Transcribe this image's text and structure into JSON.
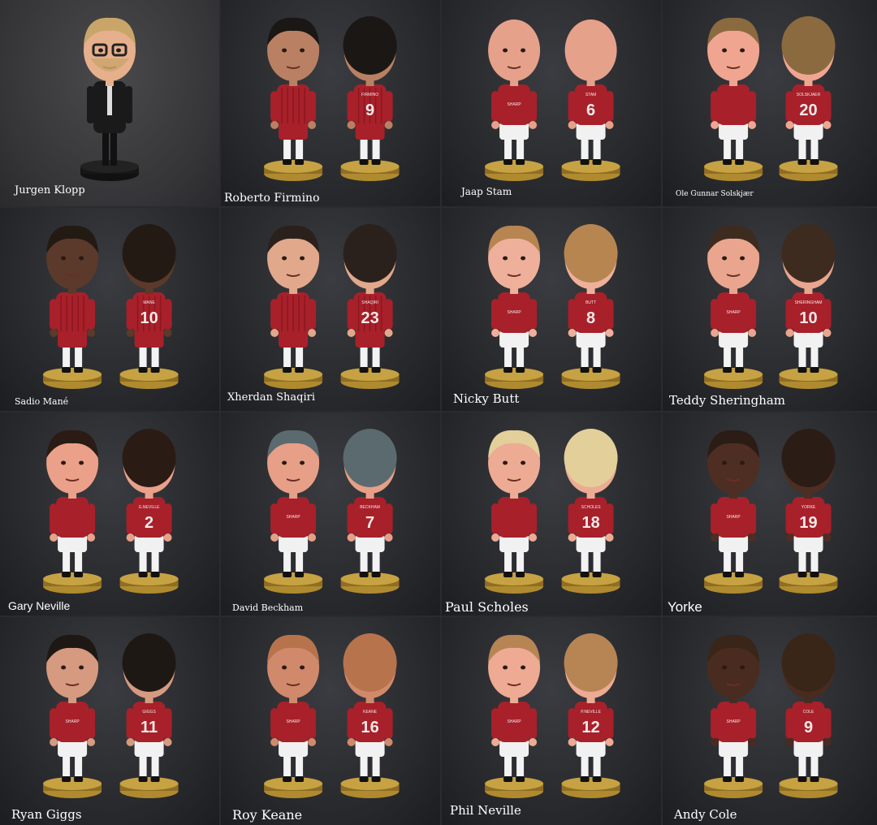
{
  "colors": {
    "skin_light": "#e9a98f",
    "skin_dark": "#5a3a2c",
    "kit_red": "#a8202a",
    "shorts_white": "#f1f1f1",
    "base_gold": "#b08a2e",
    "background": "#2a2b2e"
  },
  "tiles": [
    {
      "name": "Jurgen Klopp",
      "front_shirt": "",
      "back_name": "",
      "back_number": "",
      "outfit": "suit"
    },
    {
      "name": "Roberto Firmino",
      "front_shirt": "",
      "back_name": "FIRMINO",
      "back_number": "9",
      "outfit": "liverpool"
    },
    {
      "name": "Jaap Stam",
      "front_shirt": "SHARP",
      "back_name": "STAM",
      "back_number": "6",
      "outfit": "united"
    },
    {
      "name": "Ole Gunnar Solskjær",
      "front_shirt": "",
      "back_name": "SOLSKJAER",
      "back_number": "20",
      "outfit": "united"
    },
    {
      "name": "Sadio Mané",
      "front_shirt": "",
      "back_name": "MANE",
      "back_number": "10",
      "outfit": "liverpool"
    },
    {
      "name": "Xherdan Shaqiri",
      "front_shirt": "",
      "back_name": "SHAQIRI",
      "back_number": "23",
      "outfit": "liverpool"
    },
    {
      "name": "Nicky Butt",
      "front_shirt": "SHARP",
      "back_name": "BUTT",
      "back_number": "8",
      "outfit": "united"
    },
    {
      "name": "Teddy Sheringham",
      "front_shirt": "SHARP",
      "back_name": "SHERINGHAM",
      "back_number": "10",
      "outfit": "united"
    },
    {
      "name": "Gary Neville",
      "front_shirt": "",
      "back_name": "G.NEVILLE",
      "back_number": "2",
      "outfit": "united"
    },
    {
      "name": "David Beckham",
      "front_shirt": "SHARP",
      "back_name": "BECKHAM",
      "back_number": "7",
      "outfit": "united"
    },
    {
      "name": "Paul Scholes",
      "front_shirt": "",
      "back_name": "SCHOLES",
      "back_number": "18",
      "outfit": "united"
    },
    {
      "name": "Yorke",
      "front_shirt": "SHARP",
      "back_name": "YORKE",
      "back_number": "19",
      "outfit": "united"
    },
    {
      "name": "Ryan Giggs",
      "front_shirt": "SHARP",
      "back_name": "GIGGS",
      "back_number": "11",
      "outfit": "united"
    },
    {
      "name": "Roy Keane",
      "front_shirt": "SHARP",
      "back_name": "KEANE",
      "back_number": "16",
      "outfit": "united"
    },
    {
      "name": "Phil Neville",
      "front_shirt": "SHARP",
      "back_name": "P.NEVILLE",
      "back_number": "12",
      "outfit": "united"
    },
    {
      "name": "Andy Cole",
      "front_shirt": "SHARP",
      "back_name": "COLE",
      "back_number": "9",
      "outfit": "united"
    }
  ]
}
